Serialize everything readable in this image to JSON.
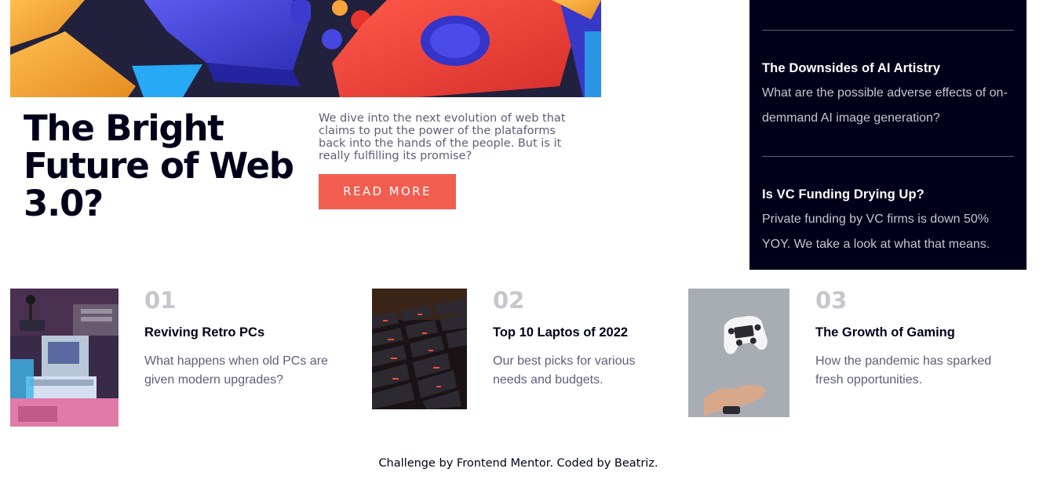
{
  "hero": {
    "title": "The Bright Future of Web 3.0?",
    "description": "We dive into the next evolution of web that claims to put the power of the plataforms back into the hands of the people. But is it really fulfilling its promise?",
    "read_more_label": "READ MORE"
  },
  "new_panel": {
    "items": [
      {
        "title": "The Downsides of AI Artistry",
        "description": "What are the possible adverse effects of on-demmand AI image generation?"
      },
      {
        "title": "Is VC Funding Drying Up?",
        "description": "Private funding by VC firms is down 50% YOY. We take a look at what that means."
      }
    ]
  },
  "articles": [
    {
      "number": "01",
      "title": "Reviving Retro PCs",
      "description": "What happens when old PCs are given modern upgrades?"
    },
    {
      "number": "02",
      "title": "Top 10 Laptos of 2022",
      "description": "Our best picks for various needs and budgets."
    },
    {
      "number": "03",
      "title": "The Growth of Gaming",
      "description": "How the pandemic has sparked fresh opportunities."
    }
  ],
  "footer": {
    "text": "Challenge by Frontend Mentor. Coded by Beatriz."
  },
  "colors": {
    "accent": "#f15e50",
    "dark_navy": "#00001a",
    "grayish_blue": "#5d5f79",
    "grayish_light": "#c5c6ce",
    "off_white": "#fffdfa"
  }
}
